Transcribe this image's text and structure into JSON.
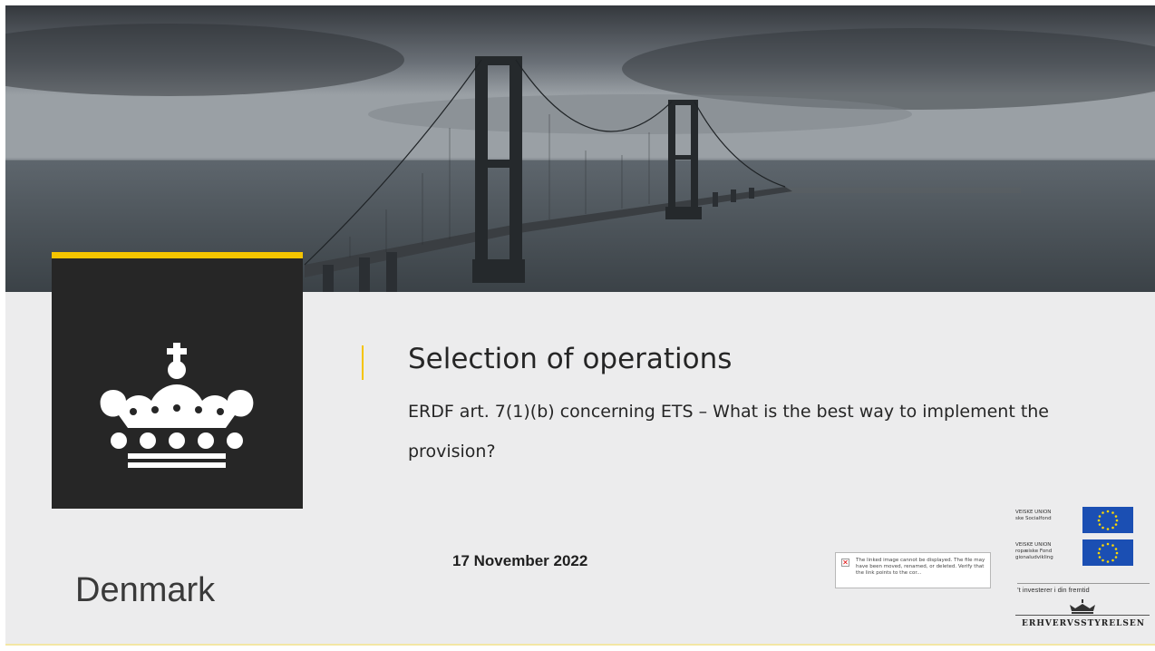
{
  "slide": {
    "title": "Selection of operations",
    "subtitle": "ERDF art. 7(1)(b) concerning ETS – What is the best way to implement the provision?",
    "date": "17 November 2022",
    "country": "Denmark"
  },
  "broken_image": {
    "message": "The linked image cannot be displayed. The file may have been moved, renamed, or deleted. Verify that the link points to the cor..."
  },
  "eu_logos": {
    "social_fund_text": "VEISKE UNION\nske Socialfond",
    "regional_fund_text": "VEISKE UNION\nropæiske Fond\ngionaludvikling",
    "tagline": "’t investerer i din fremtid",
    "agency_name": "ERHVERVSSTYRELSEN"
  },
  "colors": {
    "accent_yellow": "#f5c400",
    "logo_box": "#262626",
    "slide_background": "#ececed",
    "eu_blue": "#1b4fb3"
  },
  "icons": {
    "main_logo": "danish-royal-crown-icon",
    "broken_image": "broken-image-icon",
    "eu_flag": "eu-flag-icon",
    "agency_logo": "small-crown-icon"
  }
}
